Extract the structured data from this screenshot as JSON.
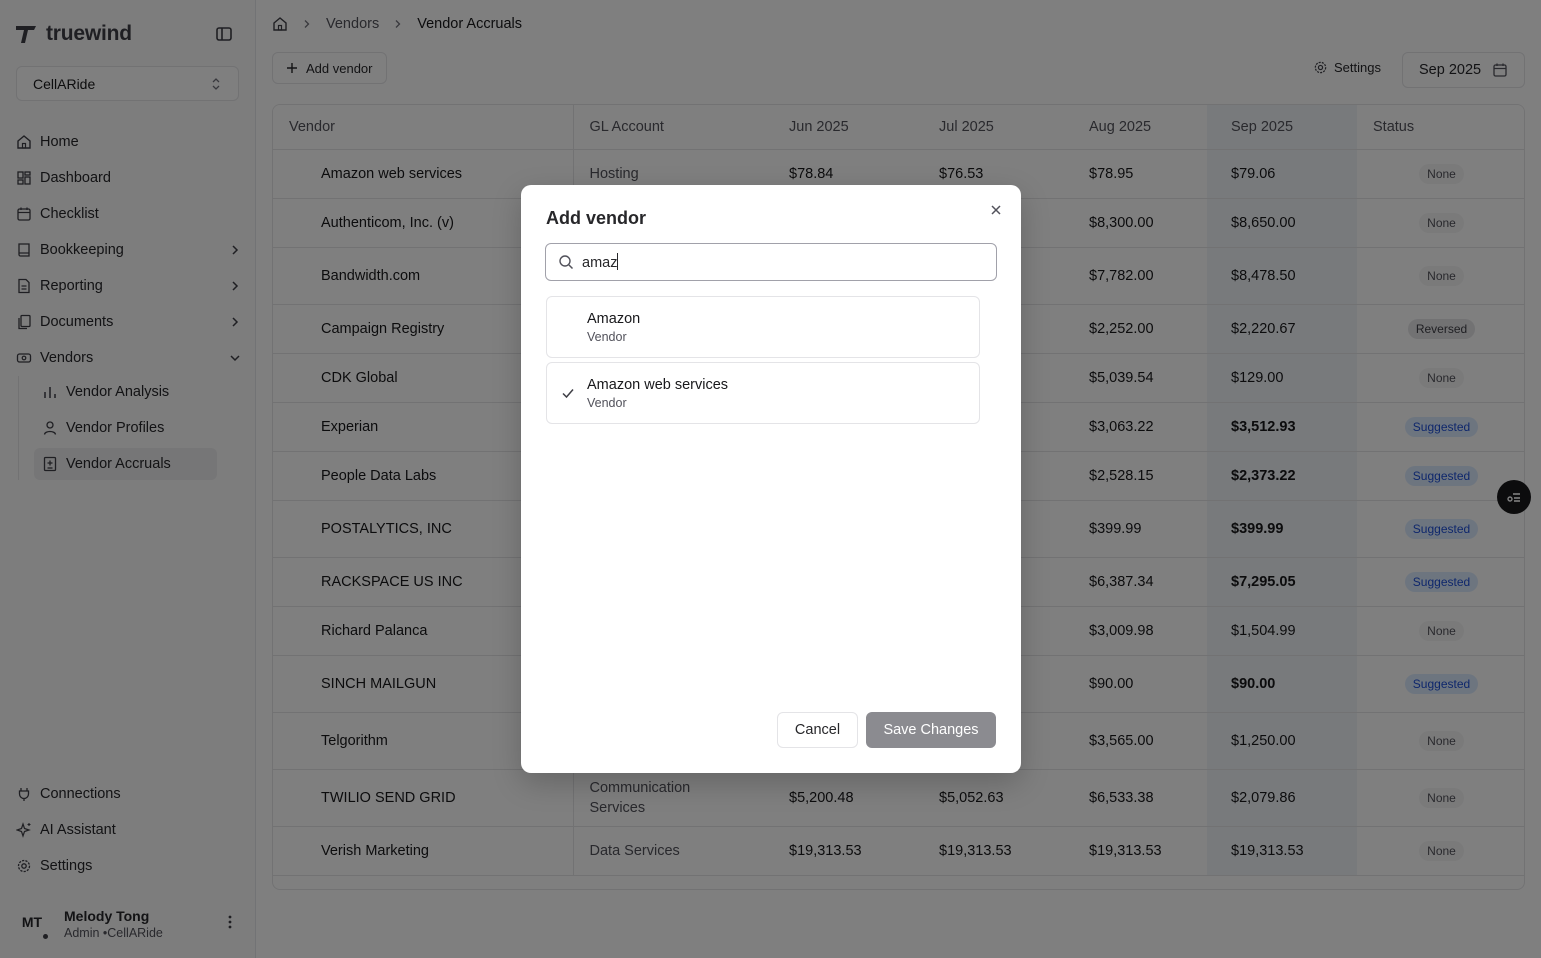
{
  "sidebar": {
    "brand": "truewind",
    "org": "CellARide",
    "nav": [
      {
        "label": "Home"
      },
      {
        "label": "Dashboard"
      },
      {
        "label": "Checklist"
      },
      {
        "label": "Bookkeeping"
      },
      {
        "label": "Reporting"
      },
      {
        "label": "Documents"
      },
      {
        "label": "Vendors"
      }
    ],
    "vendors_sub": [
      {
        "label": "Vendor Analysis"
      },
      {
        "label": "Vendor Profiles"
      },
      {
        "label": "Vendor Accruals"
      }
    ],
    "bottom": [
      {
        "label": "Connections"
      },
      {
        "label": "AI Assistant"
      },
      {
        "label": "Settings"
      }
    ],
    "user": {
      "initials": "MT",
      "name": "Melody Tong",
      "role": "Admin •CellARide"
    }
  },
  "breadcrumb": {
    "vendors": "Vendors",
    "current": "Vendor Accruals"
  },
  "toolbar": {
    "add_vendor": "Add vendor",
    "settings": "Settings",
    "period": "Sep 2025"
  },
  "table": {
    "headers": [
      "Vendor",
      "GL Account",
      "Jun 2025",
      "Jul 2025",
      "Aug 2025",
      "Sep 2025",
      "Status"
    ],
    "rows": [
      {
        "vendor": "Amazon web services",
        "gl": "Hosting",
        "jun": "$78.84",
        "jul": "$76.53",
        "aug": "$78.95",
        "sep": "$79.06",
        "status": "None",
        "sep_bold": false
      },
      {
        "vendor": "Authenticom, Inc. (v)",
        "gl": "",
        "jun": "",
        "jul": "",
        "aug": "$8,300.00",
        "sep": "$8,650.00",
        "status": "None",
        "sep_bold": false
      },
      {
        "vendor": "Bandwidth.com",
        "gl": "",
        "jun": "",
        "jul": "",
        "aug": "$7,782.00",
        "sep": "$8,478.50",
        "status": "None",
        "sep_bold": false
      },
      {
        "vendor": "Campaign Registry",
        "gl": "",
        "jun": "",
        "jul": "",
        "aug": "$2,252.00",
        "sep": "$2,220.67",
        "status": "Reversed",
        "sep_bold": false
      },
      {
        "vendor": "CDK Global",
        "gl": "",
        "jun": "",
        "jul": "",
        "aug": "$5,039.54",
        "sep": "$129.00",
        "status": "None",
        "sep_bold": false
      },
      {
        "vendor": "Experian",
        "gl": "",
        "jun": "",
        "jul": "",
        "aug": "$3,063.22",
        "sep": "$3,512.93",
        "status": "Suggested",
        "sep_bold": true
      },
      {
        "vendor": "People Data Labs",
        "gl": "",
        "jun": "",
        "jul": "",
        "aug": "$2,528.15",
        "sep": "$2,373.22",
        "status": "Suggested",
        "sep_bold": true
      },
      {
        "vendor": "POSTALYTICS, INC",
        "gl": "",
        "jun": "",
        "jul": "",
        "aug": "$399.99",
        "sep": "$399.99",
        "status": "Suggested",
        "sep_bold": true
      },
      {
        "vendor": "RACKSPACE US INC",
        "gl": "",
        "jun": "",
        "jul": "",
        "aug": "$6,387.34",
        "sep": "$7,295.05",
        "status": "Suggested",
        "sep_bold": true
      },
      {
        "vendor": "Richard Palanca",
        "gl": "",
        "jun": "",
        "jul": "",
        "aug": "$3,009.98",
        "sep": "$1,504.99",
        "status": "None",
        "sep_bold": false
      },
      {
        "vendor": "SINCH MAILGUN",
        "gl": "",
        "jun": "",
        "jul": "",
        "aug": "$90.00",
        "sep": "$90.00",
        "status": "Suggested",
        "sep_bold": true
      },
      {
        "vendor": "Telgorithm",
        "gl": "",
        "jun": "",
        "jul": "",
        "aug": "$3,565.00",
        "sep": "$1,250.00",
        "status": "None",
        "sep_bold": false
      },
      {
        "vendor": "TWILIO SEND GRID",
        "gl": "Communication Services",
        "jun": "$5,200.48",
        "jul": "$5,052.63",
        "aug": "$6,533.38",
        "sep": "$2,079.86",
        "status": "None",
        "sep_bold": false
      },
      {
        "vendor": "Verish Marketing",
        "gl": "Data Services",
        "jun": "$19,313.53",
        "jul": "$19,313.53",
        "aug": "$19,313.53",
        "sep": "$19,313.53",
        "status": "None",
        "sep_bold": false
      }
    ]
  },
  "modal": {
    "title": "Add vendor",
    "search_value": "amaz",
    "results": [
      {
        "name": "Amazon",
        "type": "Vendor",
        "selected": false
      },
      {
        "name": "Amazon web services",
        "type": "Vendor",
        "selected": true
      }
    ],
    "cancel": "Cancel",
    "save": "Save Changes"
  },
  "colors": {
    "accent_sep_column": "#f1f5f9",
    "suggested_badge": "#dbeafe",
    "save_disabled": "#8b8b90"
  }
}
